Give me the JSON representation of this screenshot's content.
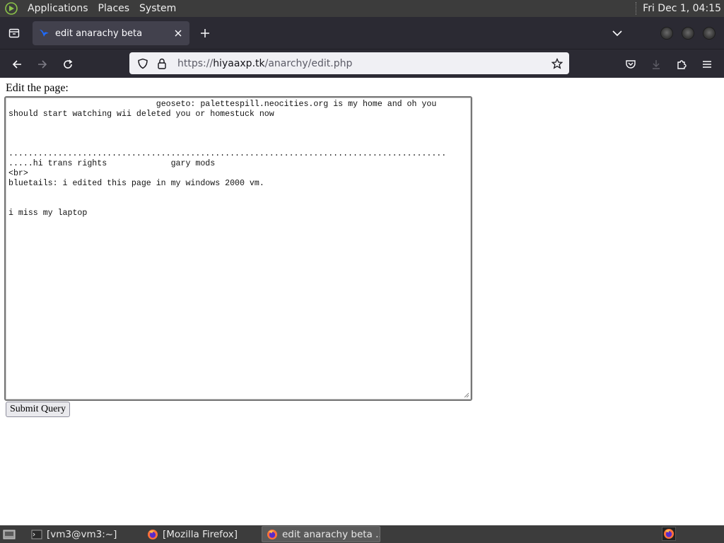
{
  "top_panel": {
    "menus": [
      "Applications",
      "Places",
      "System"
    ],
    "clock": "Fri Dec 1, 04:15"
  },
  "browser": {
    "tab": {
      "title": "edit anarachy beta"
    },
    "url": {
      "scheme": "https://",
      "host": "hiyaaxp.tk",
      "path": "/anarchy/edit.php"
    }
  },
  "page": {
    "label": "Edit the page:",
    "textarea_content": "                              geoseto: palettespill.neocities.org is my home and oh you should start watching wii deleted you or homestuck now\n\n\n\n.........................................................................................\n.....hi trans rights             gary mods\n<br>\nbluetails: i edited this page in my windows 2000 vm.\n\n\ni miss my laptop",
    "submit_label": "Submit Query"
  },
  "taskbar": {
    "tasks": [
      {
        "label": "[vm3@vm3:~]",
        "icon": "terminal-icon",
        "active": false
      },
      {
        "label": "[Mozilla Firefox]",
        "icon": "firefox-icon",
        "active": false
      },
      {
        "label": "edit anarachy beta ...",
        "icon": "firefox-icon",
        "active": true
      }
    ]
  },
  "colors": {
    "panel_bg": "#3c3c3c",
    "toolbar_bg": "#2b2a33",
    "tab_active_bg": "#42414d",
    "urlbar_bg": "#f0f0f4"
  }
}
